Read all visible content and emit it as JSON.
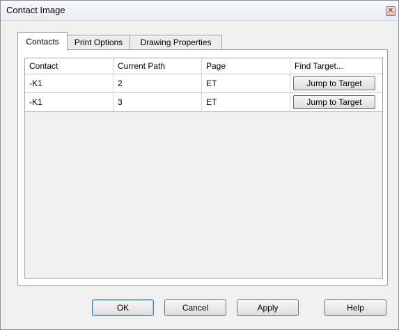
{
  "window": {
    "title": "Contact Image"
  },
  "tabs": [
    {
      "label": "Contacts",
      "active": true
    },
    {
      "label": "Print Options",
      "active": false
    },
    {
      "label": "Drawing Properties",
      "active": false
    }
  ],
  "grid": {
    "columns": [
      "Contact",
      "Current Path",
      "Page",
      "Find Target..."
    ],
    "rows": [
      {
        "contact": "-K1",
        "path": "2",
        "page": "ET",
        "action": "Jump to Target"
      },
      {
        "contact": "-K1",
        "path": "3",
        "page": "ET",
        "action": "Jump to Target"
      }
    ]
  },
  "buttons": {
    "ok": "OK",
    "cancel": "Cancel",
    "apply": "Apply",
    "help": "Help"
  },
  "icons": {
    "close": "close-icon"
  }
}
